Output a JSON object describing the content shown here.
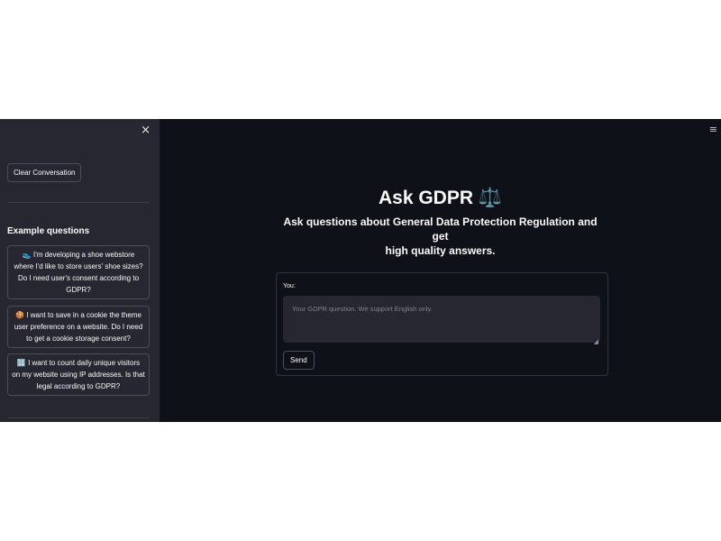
{
  "sidebar": {
    "close_icon": "×",
    "clear_button": "Clear Conversation",
    "heading": "Example questions",
    "examples": [
      {
        "icon": "👟",
        "line1": "I'm developing a shoe webstore",
        "line2": "where I'd like to store users' shoe sizes?",
        "line3": "Do I need user's consent according to",
        "line4": "GDPR?"
      },
      {
        "icon": "🍪",
        "line1": "I want to save in a cookie the theme",
        "line2": "user preference on a website. Do I need",
        "line3": "to get a cookie storage consent?"
      },
      {
        "icon": "🔢",
        "line1": "I want to count daily unique visitors",
        "line2": "on my website using IP addresses. Is that",
        "line3": "legal according to GDPR?"
      }
    ]
  },
  "main": {
    "menu_icon": "≡",
    "title": "Ask GDPR",
    "title_icon": "⚖️",
    "subtitle_line1": "Ask questions about General Data Protection Regulation and get",
    "subtitle_line2": "high quality answers.",
    "form": {
      "label": "You:",
      "placeholder": "Your GDPR question. We support English only.",
      "send_button": "Send"
    }
  },
  "colors": {
    "main_background": "#0e1117",
    "sidebar_background": "#262730",
    "text": "#fafafa"
  }
}
